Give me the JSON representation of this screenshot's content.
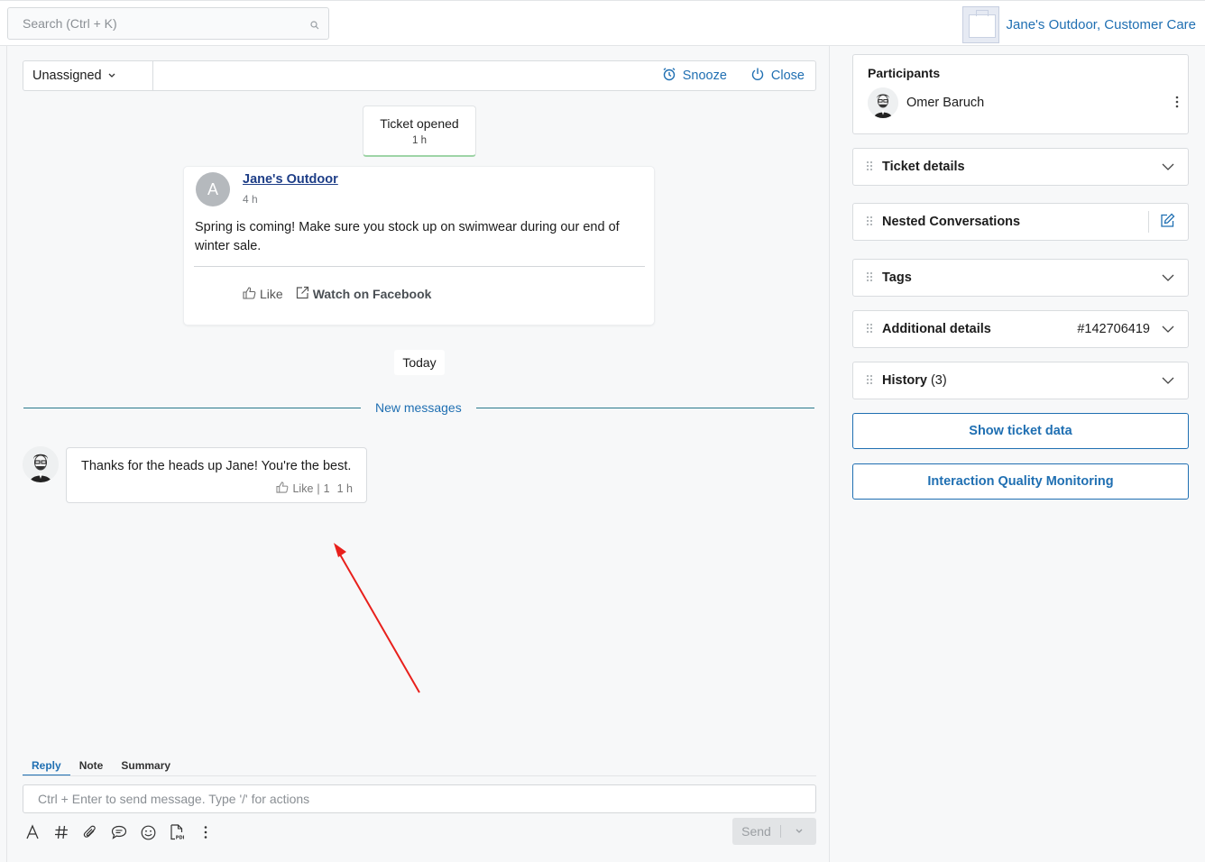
{
  "topbar": {
    "search_placeholder": "Search (Ctrl + K)",
    "brand_name": "Jane's Outdoor, Customer Care"
  },
  "ticket_bar": {
    "assignee": "Unassigned",
    "snooze_label": "Snooze",
    "close_label": "Close"
  },
  "timeline": {
    "system_event": {
      "title": "Ticket opened",
      "time": "1 h"
    },
    "post": {
      "avatar_letter": "A",
      "author": "Jane's Outdoor",
      "time": "4 h",
      "text": "Spring is coming! Make sure you stock up on swimwear during our end of winter sale.",
      "like_label": "Like",
      "watch_label": "Watch on Facebook"
    },
    "day_separator": "Today",
    "new_messages_label": "New messages",
    "message": {
      "text": "Thanks for the heads up Jane! You're the best.",
      "like_label": "Like",
      "separator": "|",
      "like_count": "1",
      "time": "1 h"
    }
  },
  "composer": {
    "tabs": [
      "Reply",
      "Note",
      "Summary"
    ],
    "active_tab": "Reply",
    "placeholder": "Ctrl + Enter to send message. Type '/' for actions",
    "send_label": "Send",
    "tools": [
      "text-format-icon",
      "hashtag-icon",
      "attachment-icon",
      "chat-bubble-icon",
      "emoji-icon",
      "pdf-icon",
      "more-icon"
    ]
  },
  "sidebar": {
    "participants_title": "Participants",
    "participant_name": "Omer Baruch",
    "sections": [
      {
        "title": "Ticket details"
      },
      {
        "title": "Nested Conversations"
      },
      {
        "title": "Tags"
      },
      {
        "title": "Additional details",
        "value": "#142706419"
      },
      {
        "title": "History",
        "count": "(3)"
      }
    ],
    "show_ticket_data": "Show ticket data",
    "iqm_button": "Interaction Quality Monitoring"
  },
  "colors": {
    "accent": "#1f6fb2",
    "author_link": "#1e3e87",
    "divider_teal": "#2a7a8c",
    "annotation_arrow": "#e8201c"
  }
}
